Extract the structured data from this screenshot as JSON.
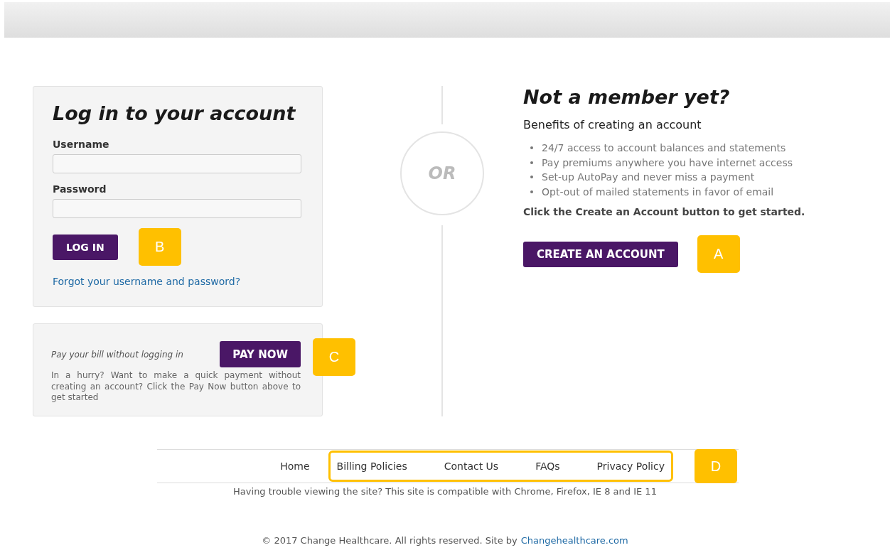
{
  "login": {
    "title": "Log in to your account",
    "fields": [
      {
        "label": "Username"
      },
      {
        "label": "Password"
      }
    ],
    "button": "LOG IN",
    "callout": "B",
    "forgot_link": "Forgot your username and password?"
  },
  "pay": {
    "title": "Pay your bill without logging in",
    "button": "PAY NOW",
    "callout": "C",
    "description": "In a hurry? Want to make a quick payment without creating an account? Click the Pay Now button above to get started"
  },
  "divider": {
    "label": "OR"
  },
  "signup": {
    "title": "Not a member yet?",
    "subtitle": "Benefits of creating an account",
    "benefits": [
      "24/7 access to account balances and statements",
      "Pay premiums anywhere you have internet access",
      "Set-up AutoPay and never miss a payment",
      "Opt-out of mailed statements in favor of email"
    ],
    "instruction": "Click the Create an Account button to get started.",
    "button": "CREATE AN ACCOUNT",
    "callout": "A"
  },
  "footer": {
    "links": [
      {
        "label": "Home",
        "highlighted": false
      },
      {
        "label": "Billing Policies",
        "highlighted": true
      },
      {
        "label": "Contact Us",
        "highlighted": true
      },
      {
        "label": "FAQs",
        "highlighted": true
      },
      {
        "label": "Privacy Policy",
        "highlighted": true
      }
    ],
    "callout": "D",
    "compatibility": "Having trouble viewing the site? This site is compatible with Chrome, Firefox, IE 8 and IE 11",
    "copyright": "© 2017 Change Healthcare. All rights reserved. Site by",
    "site_link": "Changehealthcare.com"
  }
}
